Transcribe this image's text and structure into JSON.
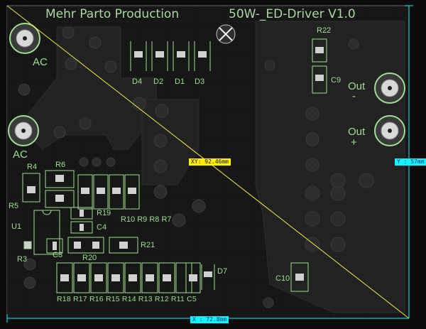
{
  "board": {
    "title_left": "Mehr Parto Production",
    "title_right": "50W-_ED-Driver V1.0"
  },
  "measure": {
    "diag_label": "XY: 92.46mm",
    "y_label": "Y : 57mm",
    "x_label": "X : 72.8mm"
  },
  "connectors": {
    "ac_top": "AC",
    "ac_bottom": "AC",
    "out_top": "Out",
    "out_top_sign": "-",
    "out_bottom": "Out",
    "out_bottom_sign": "+"
  },
  "components": {
    "d4": "D4",
    "d2": "D2",
    "d1": "D1",
    "d3": "D3",
    "r22": "R22",
    "c9": "C9",
    "r4": "R4",
    "r6": "R6",
    "r5": "R5",
    "r19": "R19",
    "c4": "C4",
    "r10r7": "R10 R9 R8 R7",
    "u1": "U1",
    "r3": "R3",
    "c3": "C3",
    "r20": "R20",
    "r21": "R21",
    "d7": "D7",
    "c10": "C10",
    "bottom_row": "R18 R17 R16 R15 R14 R13 R12 R11  C5"
  },
  "colors": {
    "board": "#161616",
    "silk": "#9be08f",
    "copper_dark": "#2a2a2a",
    "measure_line": "#f5e642"
  }
}
